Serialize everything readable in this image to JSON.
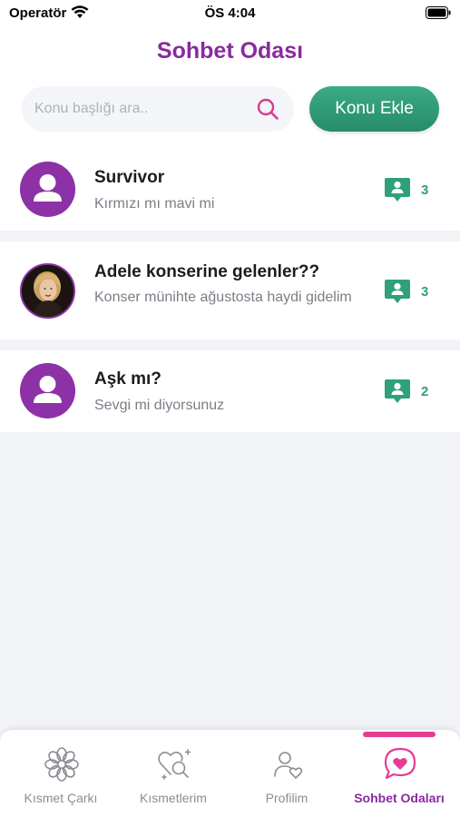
{
  "status_bar": {
    "carrier": "Operatör",
    "time": "ÖS 4:04"
  },
  "header": {
    "title": "Sohbet Odası",
    "title_color": "#8a2aa0"
  },
  "search": {
    "placeholder": "Konu başlığı ara..",
    "value": "",
    "icon": "search-icon",
    "icon_color": "#d63c8f"
  },
  "add_topic_button": {
    "label": "Konu Ekle",
    "color": "#2f9a74"
  },
  "topics": [
    {
      "title": "Survivor",
      "description": "Kırmızı mı mavi mi",
      "count": "3",
      "avatar": "default-user-avatar"
    },
    {
      "title": "Adele konserine gelenler??",
      "description": "Konser münihte ağustosta haydi gidelim",
      "count": "3",
      "avatar": "photo-avatar"
    },
    {
      "title": "Aşk mı?",
      "description": "Sevgi mi diyorsunuz",
      "count": "2",
      "avatar": "default-user-avatar"
    }
  ],
  "tab_bar": {
    "items": [
      {
        "label": "Kısmet Çarkı",
        "icon": "flower-wheel-icon",
        "active": false
      },
      {
        "label": "Kısmetlerim",
        "icon": "heart-search-icon",
        "active": false
      },
      {
        "label": "Profilim",
        "icon": "profile-heart-icon",
        "active": false
      },
      {
        "label": "Sohbet Odaları",
        "icon": "chat-heart-icon",
        "active": true
      }
    ],
    "active_color": "#8a2aa0",
    "indicator_color": "#e63b95"
  },
  "colors": {
    "accent_purple": "#8c32a6",
    "accent_green": "#2fa07a",
    "accent_pink": "#e63b95",
    "background": "#f1f3f7"
  }
}
